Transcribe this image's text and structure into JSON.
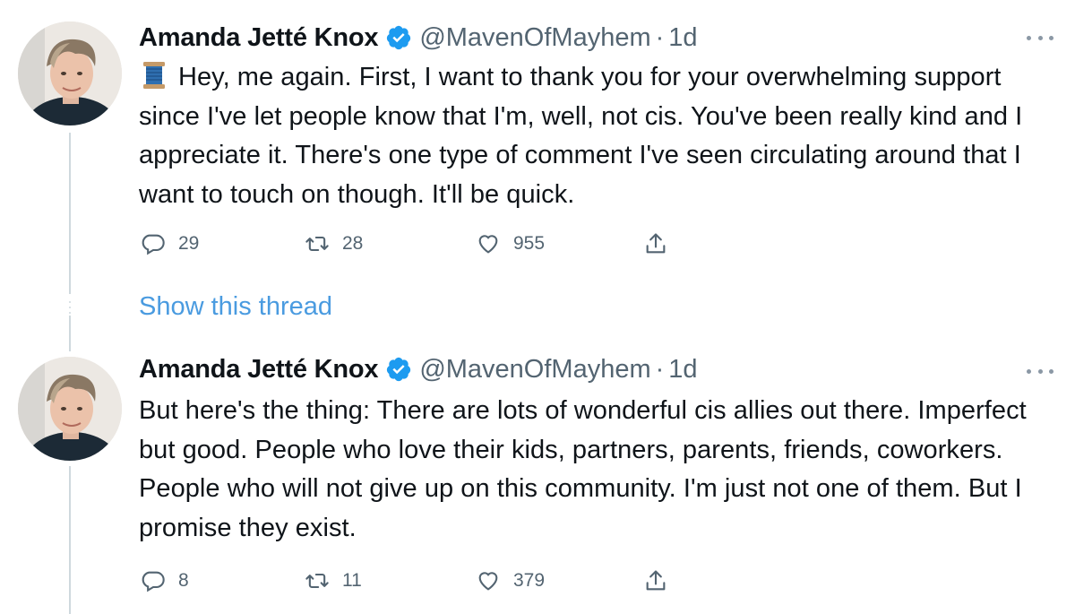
{
  "tweets": [
    {
      "author_name": "Amanda Jetté Knox",
      "handle": "@MavenOfMayhem",
      "separator": "·",
      "time": "1d",
      "text": "Hey, me again. First, I want to thank you for your overwhelming support since I've let people know that I'm, well, not cis. You've been really kind and I appreciate it. There's one type of comment I've seen circulating around that I want to touch on though. It'll be quick.",
      "leading_emoji": "thread-spool-icon",
      "replies": "29",
      "retweets": "28",
      "likes": "955"
    },
    {
      "author_name": "Amanda Jetté Knox",
      "handle": "@MavenOfMayhem",
      "separator": "·",
      "time": "1d",
      "text": "But here's the thing: There are lots of wonderful cis allies out there. Imperfect but good. People who love their kids, partners, parents, friends, coworkers. People who will not give up on this community. I'm just not one of them. But I promise they exist.",
      "replies": "8",
      "retweets": "11",
      "likes": "379"
    }
  ],
  "show_thread_label": "Show this thread",
  "colors": {
    "text": "#0f1419",
    "secondary": "#536471",
    "link": "#4a9be0",
    "verified": "#1d9bf0",
    "thread_line": "#cfd9de"
  }
}
